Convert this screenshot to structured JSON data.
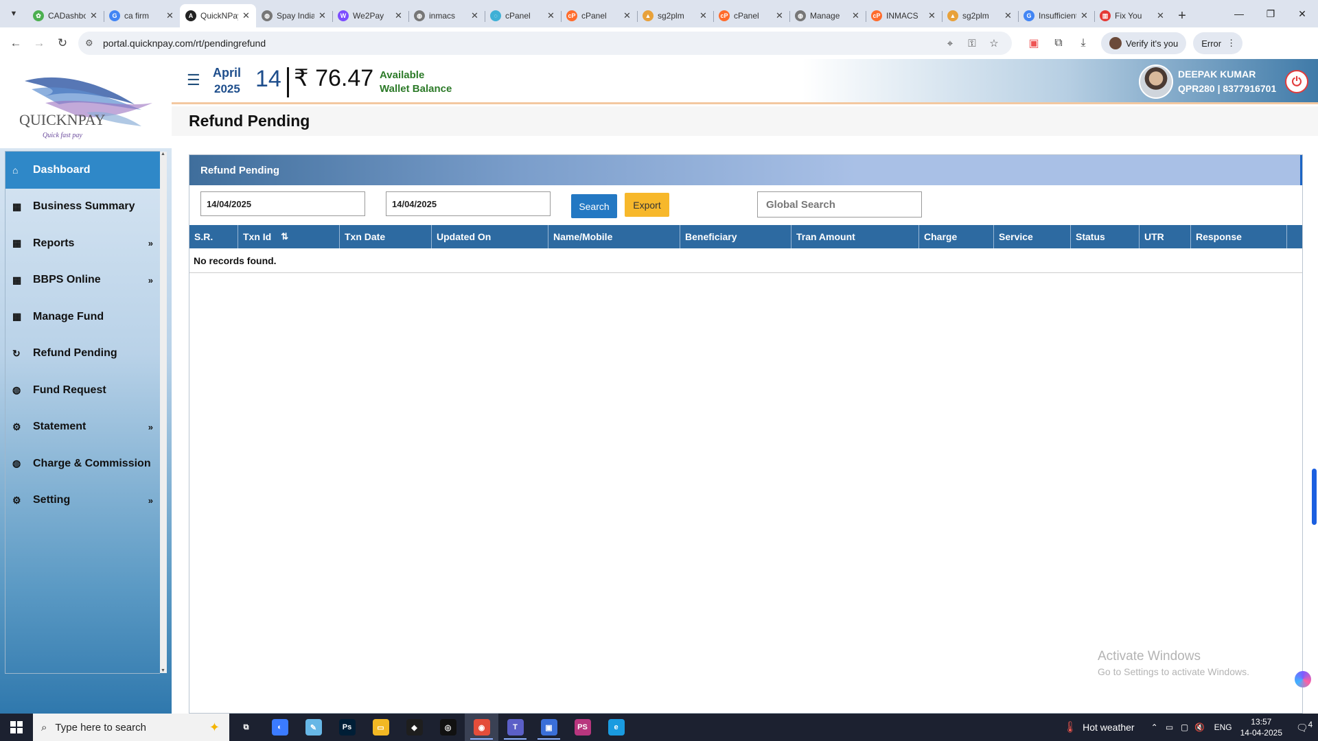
{
  "browser": {
    "tabs": [
      {
        "label": "CADashboard",
        "favicon_color": "#4caf50",
        "favicon_glyph": "✿"
      },
      {
        "label": "ca firm",
        "favicon_color": "#4285f4",
        "favicon_glyph": "G"
      },
      {
        "label": "QuickNPay",
        "favicon_color": "#222222",
        "favicon_glyph": "A"
      },
      {
        "label": "Spay India",
        "favicon_color": "#777777",
        "favicon_glyph": "◍"
      },
      {
        "label": "We2Pay",
        "favicon_color": "#7c4dff",
        "favicon_glyph": "W"
      },
      {
        "label": "inmacs",
        "favicon_color": "#777777",
        "favicon_glyph": "◍"
      },
      {
        "label": "cPanel",
        "favicon_color": "#3fb0d6",
        "favicon_glyph": "◌"
      },
      {
        "label": "cPanel",
        "favicon_color": "#ff6c2c",
        "favicon_glyph": "cP"
      },
      {
        "label": "sg2plm",
        "favicon_color": "#e8a13a",
        "favicon_glyph": "▲"
      },
      {
        "label": "cPanel",
        "favicon_color": "#ff6c2c",
        "favicon_glyph": "cP"
      },
      {
        "label": "Manage",
        "favicon_color": "#777777",
        "favicon_glyph": "◍"
      },
      {
        "label": "INMACS",
        "favicon_color": "#ff6c2c",
        "favicon_glyph": "cP"
      },
      {
        "label": "sg2plm",
        "favicon_color": "#e8a13a",
        "favicon_glyph": "▲"
      },
      {
        "label": "Insufficient",
        "favicon_color": "#4285f4",
        "favicon_glyph": "G"
      },
      {
        "label": "Fix You",
        "favicon_color": "#e53935",
        "favicon_glyph": "▥"
      }
    ],
    "active_tab_index": 2,
    "close_glyph": "✕",
    "new_tab_glyph": "+",
    "url": "portal.quicknpay.com/rt/pendingrefund",
    "verify_label": "Verify it's you",
    "error_label": "Error",
    "window_controls": [
      "—",
      "❐",
      "✕"
    ]
  },
  "logo": {
    "brand": "QUICKNPAY",
    "tagline": "Quick fast pay"
  },
  "sidebar": {
    "items": [
      {
        "label": "Dashboard",
        "icon": "home-icon",
        "glyph": "⌂",
        "active": true,
        "has_submenu": false
      },
      {
        "label": "Business Summary",
        "icon": "calendar-icon",
        "glyph": "▦",
        "active": false,
        "has_submenu": false
      },
      {
        "label": "Reports",
        "icon": "calendar-icon",
        "glyph": "▦",
        "active": false,
        "has_submenu": true
      },
      {
        "label": "BBPS Online",
        "icon": "calendar-icon",
        "glyph": "▦",
        "active": false,
        "has_submenu": true
      },
      {
        "label": "Manage Fund",
        "icon": "calendar-icon",
        "glyph": "▦",
        "active": false,
        "has_submenu": false
      },
      {
        "label": "Refund Pending",
        "icon": "refresh-icon",
        "glyph": "↻",
        "active": false,
        "has_submenu": false
      },
      {
        "label": "Fund Request",
        "icon": "globe-icon",
        "glyph": "◍",
        "active": false,
        "has_submenu": false
      },
      {
        "label": "Statement",
        "icon": "gear-icon",
        "glyph": "⚙",
        "active": false,
        "has_submenu": true
      },
      {
        "label": "Charge & Commission",
        "icon": "globe-icon",
        "glyph": "◍",
        "active": false,
        "has_submenu": false
      },
      {
        "label": "Setting",
        "icon": "gear-icon",
        "glyph": "⚙",
        "active": false,
        "has_submenu": true
      }
    ],
    "chevron_glyph": "»"
  },
  "header": {
    "month": "April",
    "year": "2025",
    "day": "14",
    "balance": "₹ 76.47",
    "balance_label_line1": "Available",
    "balance_label_line2": "Wallet Balance",
    "user_name": "DEEPAK KUMAR",
    "user_code": "QPR280 | 8377916701"
  },
  "page": {
    "title": "Refund Pending"
  },
  "panel": {
    "title": "Refund Pending",
    "from_date": "14/04/2025",
    "to_date": "14/04/2025",
    "search_label": "Search",
    "export_label": "Export",
    "global_search_placeholder": "Global Search",
    "columns": [
      {
        "label": "S.R.",
        "width": 71
      },
      {
        "label": "Txn Id",
        "width": 148,
        "sortable": true
      },
      {
        "label": "Txn Date",
        "width": 134
      },
      {
        "label": "Updated On",
        "width": 170
      },
      {
        "label": "Name/Mobile",
        "width": 192
      },
      {
        "label": "Beneficiary",
        "width": 162
      },
      {
        "label": "Tran Amount",
        "width": 186
      },
      {
        "label": "Charge",
        "width": 109
      },
      {
        "label": "Service",
        "width": 112
      },
      {
        "label": "Status",
        "width": 100
      },
      {
        "label": "UTR",
        "width": 75
      },
      {
        "label": "Response",
        "width": 140
      }
    ],
    "empty_message": "No records found.",
    "sort_glyph": "⇅"
  },
  "watermark": {
    "line1": "Activate Windows",
    "line2": "Go to Settings to activate Windows."
  },
  "taskbar": {
    "search_placeholder": "Type here to search",
    "apps": [
      {
        "name": "task-view",
        "color": "transparent",
        "glyph": "⧉",
        "open": false
      },
      {
        "name": "copilot",
        "color": "#3b7bff",
        "glyph": "◐",
        "open": false
      },
      {
        "name": "notepad",
        "color": "#67b7e6",
        "glyph": "✎",
        "open": false
      },
      {
        "name": "photoshop",
        "color": "#001e36",
        "glyph": "Ps",
        "open": false
      },
      {
        "name": "file-explorer",
        "color": "#f2b824",
        "glyph": "▭",
        "open": false
      },
      {
        "name": "figma",
        "color": "#1e1e1e",
        "glyph": "◆",
        "open": false
      },
      {
        "name": "app-circle",
        "color": "#111111",
        "glyph": "◎",
        "open": false
      },
      {
        "name": "chrome",
        "color": "#e44d3a",
        "glyph": "◉",
        "open": true,
        "current": true
      },
      {
        "name": "teams",
        "color": "#5b5fc7",
        "glyph": "T",
        "open": true
      },
      {
        "name": "app-window",
        "color": "#3a6fd8",
        "glyph": "▣",
        "open": true
      },
      {
        "name": "phpstorm",
        "color": "#b8367e",
        "glyph": "PS",
        "open": false
      },
      {
        "name": "edge",
        "color": "#1a9be0",
        "glyph": "e",
        "open": false
      }
    ],
    "weather": "Hot weather",
    "language": "ENG",
    "time": "13:57",
    "date": "14-04-2025",
    "notification_count": "4"
  }
}
